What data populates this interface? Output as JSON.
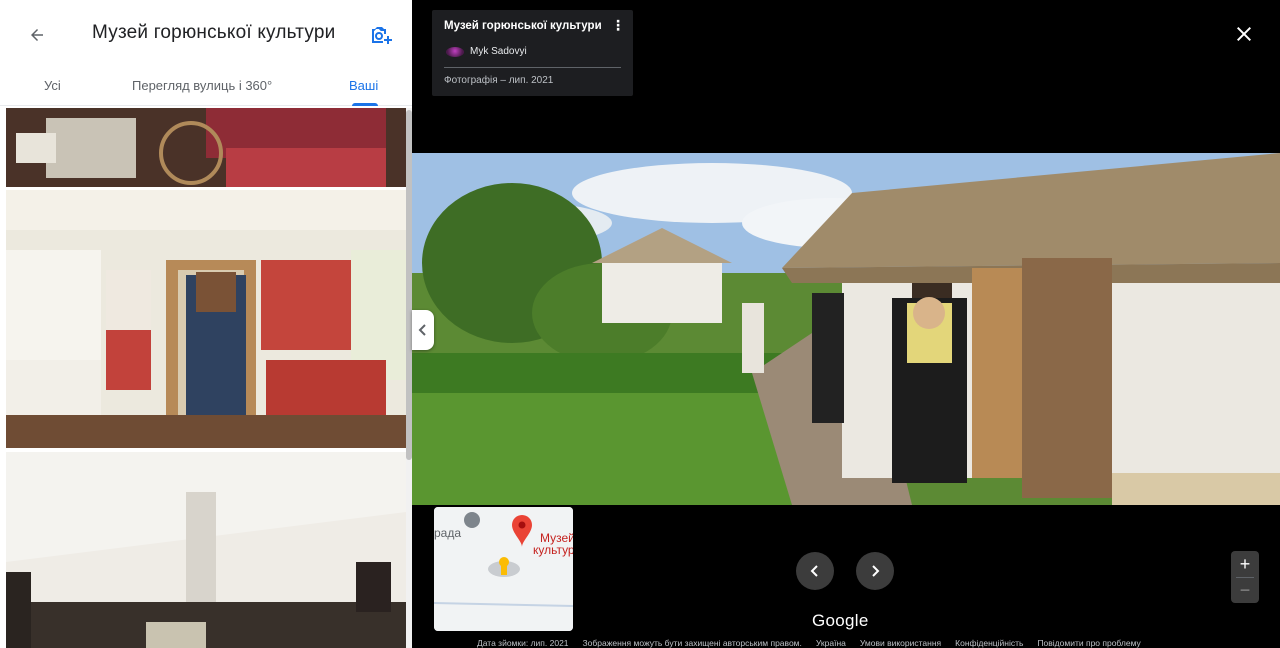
{
  "left_panel": {
    "title": "Музей горюнської культури",
    "tabs": [
      {
        "label": "Усі"
      },
      {
        "label": "Перегляд вулиць і 360°"
      },
      {
        "label": "Ваші"
      }
    ]
  },
  "viewer": {
    "info_card": {
      "title": "Музей горюнської культури",
      "author": "Myk Sadovyi",
      "date": "Фотографія – лип. 2021"
    },
    "minimap": {
      "place_label_line1": "Музей",
      "place_label_line2": "культур",
      "nearby_label": "рада"
    },
    "google_logo": "Google",
    "footer": {
      "capture_date": "Дата зйомки: лип. 2021",
      "copyright": "Зображення можуть бути захищені авторським правом.",
      "country": "Україна",
      "terms": "Умови використання",
      "privacy": "Конфіденційність",
      "report": "Повідомити про проблему"
    }
  },
  "colors": {
    "accent": "#1a73e8",
    "pin": "#ea4335"
  }
}
